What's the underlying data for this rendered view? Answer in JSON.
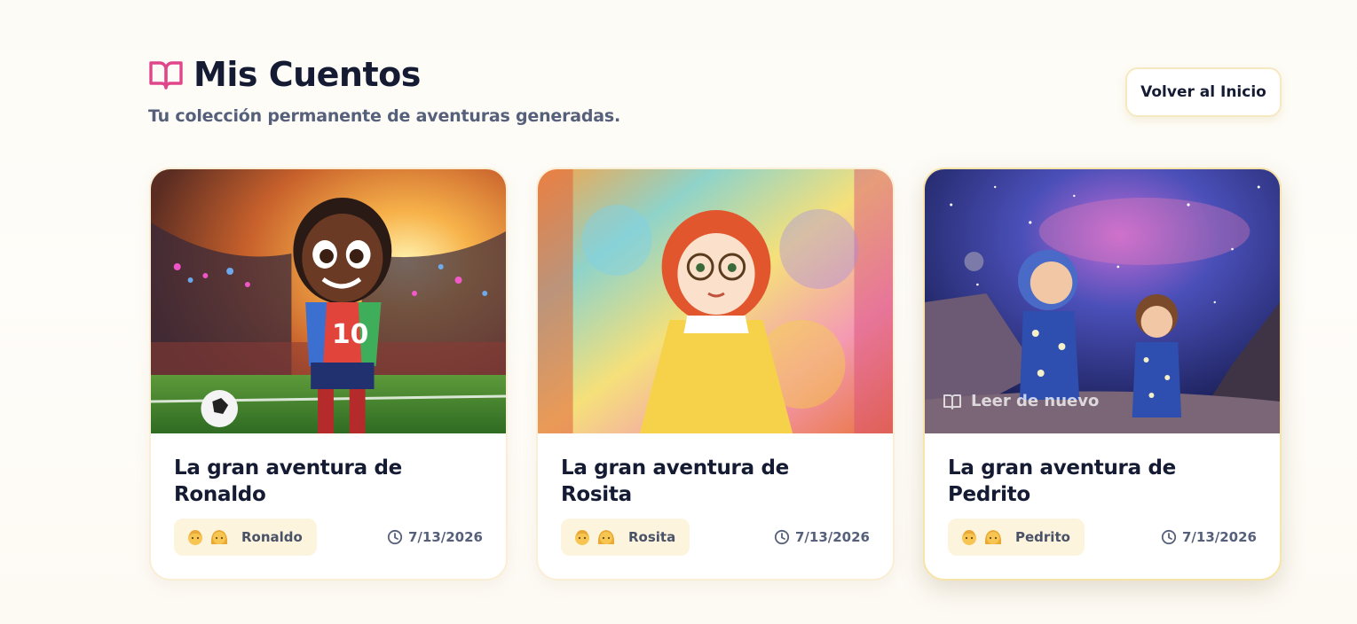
{
  "header": {
    "title": "Mis Cuentos",
    "subtitle": "Tu colección permanente de aventuras generadas.",
    "icon": "open-book-icon",
    "accent": "#e0478a"
  },
  "actions": {
    "back_label": "Volver al Inicio"
  },
  "stories": [
    {
      "title": "La gran aventura de Ronaldo",
      "character": "Ronaldo",
      "date": "7/13/2026",
      "cover": "child-soccer-stadium"
    },
    {
      "title": "La gran aventura de Rosita",
      "character": "Rosita",
      "date": "7/13/2026",
      "cover": "girl-watercolor-glasses"
    },
    {
      "title": "La gran aventura de Pedrito",
      "character": "Pedrito",
      "date": "7/13/2026",
      "cover": "astronaut-kids-galaxy",
      "hover_label": "Leer de nuevo"
    }
  ],
  "colors": {
    "chip_bg": "#fdf4de",
    "title": "#141b33",
    "muted": "#56607a"
  }
}
